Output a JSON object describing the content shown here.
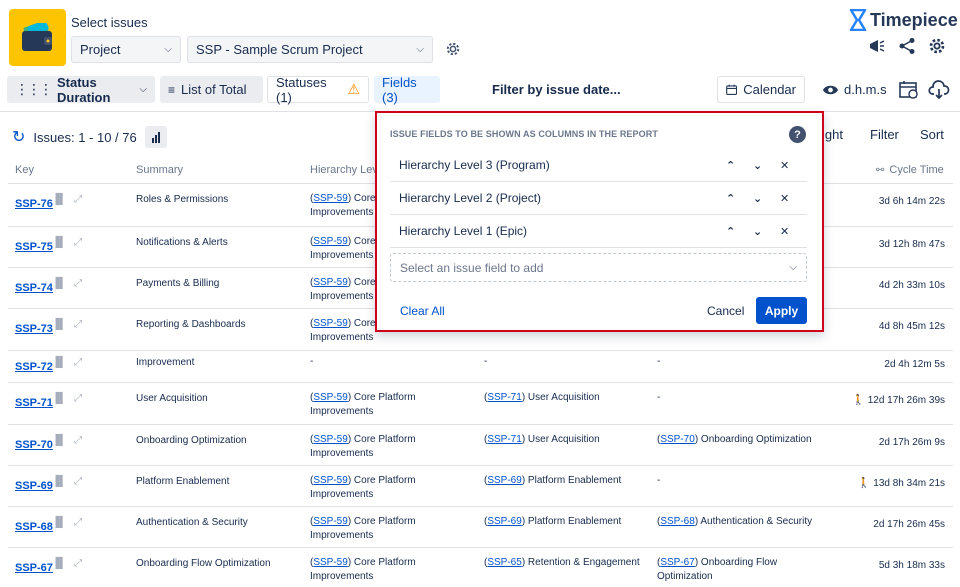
{
  "header": {
    "select_title": "Select issues",
    "scope_dropdown": "Project",
    "project_dropdown": "SSP - Sample Scrum Project",
    "brand": "Timepiece"
  },
  "toolbar": {
    "status_duration": "Status Duration",
    "list_of_total": "List of Total",
    "statuses": "Statuses (1)",
    "fields": "Fields (3)",
    "filter_date": "Filter by issue date...",
    "calendar": "Calendar",
    "dhms": "d.h.m.s"
  },
  "issues": {
    "count": "Issues: 1 - 10 / 76",
    "tab_right_partial": "ight",
    "filter": "Filter",
    "sort": "Sort"
  },
  "columns": {
    "key": "Key",
    "summary": "Summary",
    "hierarchy": "Hierarchy Leve",
    "cycle": "Cycle Time"
  },
  "rows": [
    {
      "key": "SSP-76",
      "summary": "Roles & Permissions",
      "l3_link": "SSP-59",
      "l3_text": " Core",
      "l3_line2": "Improvements",
      "l2_link": "",
      "l2_text": "",
      "l1_link": "",
      "l1_text": "",
      "l1_line2": "",
      "cycle": "3d 6h 14m 22s"
    },
    {
      "key": "SSP-75",
      "summary": "Notifications & Alerts",
      "l3_link": "SSP-59",
      "l3_text": " Core",
      "l3_line2": "Improvements",
      "l2_link": "",
      "l2_text": "",
      "l1_link": "",
      "l1_text": "",
      "l1_line2": "",
      "cycle": "3d 12h 8m 47s"
    },
    {
      "key": "SSP-74",
      "summary": "Payments & Billing",
      "l3_link": "SSP-59",
      "l3_text": " Core",
      "l3_line2": "Improvements",
      "l2_link": "",
      "l2_text": "",
      "l1_link": "",
      "l1_text": "",
      "l1_line2": "",
      "cycle": "4d 2h 33m 10s"
    },
    {
      "key": "SSP-73",
      "summary": "Reporting & Dashboards",
      "l3_link": "SSP-59",
      "l3_text": " Core",
      "l3_line2": "Improvements",
      "l2_link": "",
      "l2_text": "",
      "l1_link": "",
      "l1_text": "",
      "l1_line2": "",
      "cycle": "4d 8h 45m 12s"
    },
    {
      "key": "SSP-72",
      "summary": "Improvement",
      "l3_link": "",
      "l3_text": "-",
      "l3_line2": "",
      "l2_link": "",
      "l2_text": "-",
      "l1_link": "",
      "l1_text": "-",
      "l1_line2": "",
      "cycle": "2d 4h 12m 5s"
    },
    {
      "key": "SSP-71",
      "summary": "User Acquisition",
      "l3_link": "SSP-59",
      "l3_text": " Core Platform",
      "l3_line2": "Improvements",
      "l2_link": "SSP-71",
      "l2_text": " User Acquisition",
      "l1_link": "",
      "l1_text": "-",
      "l1_line2": "",
      "cycle": "12d 17h 26m 39s"
    },
    {
      "key": "SSP-70",
      "summary": "Onboarding Optimization",
      "l3_link": "SSP-59",
      "l3_text": " Core Platform",
      "l3_line2": "Improvements",
      "l2_link": "SSP-71",
      "l2_text": " User Acquisition",
      "l1_link": "SSP-70",
      "l1_text": " Onboarding Optimization",
      "l1_line2": "",
      "cycle": "2d 17h 26m 9s"
    },
    {
      "key": "SSP-69",
      "summary": "Platform Enablement",
      "l3_link": "SSP-59",
      "l3_text": " Core Platform",
      "l3_line2": "Improvements",
      "l2_link": "SSP-69",
      "l2_text": " Platform Enablement",
      "l1_link": "",
      "l1_text": "-",
      "l1_line2": "",
      "cycle": "13d 8h 34m 21s"
    },
    {
      "key": "SSP-68",
      "summary": "Authentication & Security",
      "l3_link": "SSP-59",
      "l3_text": " Core Platform",
      "l3_line2": "Improvements",
      "l2_link": "SSP-69",
      "l2_text": " Platform Enablement",
      "l1_link": "SSP-68",
      "l1_text": " Authentication & Security",
      "l1_line2": "",
      "cycle": "2d 17h 26m 45s"
    },
    {
      "key": "SSP-67",
      "summary": "Onboarding Flow Optimization",
      "l3_link": "SSP-59",
      "l3_text": " Core Platform",
      "l3_line2": "Improvements",
      "l2_link": "SSP-65",
      "l2_text": " Retention & Engagement",
      "l1_link": "SSP-67",
      "l1_text": " Onboarding Flow",
      "l1_line2": "Optimization",
      "cycle": "5d 3h 18m 33s"
    }
  ],
  "modal": {
    "title": "ISSUE FIELDS TO BE SHOWN AS COLUMNS IN THE REPORT",
    "help": "?",
    "fields": [
      "Hierarchy Level 3 (Program)",
      "Hierarchy Level 2 (Project)",
      "Hierarchy Level 1 (Epic)"
    ],
    "select_placeholder": "Select an issue field to add",
    "clear_all": "Clear All",
    "cancel": "Cancel",
    "apply": "Apply"
  },
  "colors": {
    "accent": "#0052cc",
    "highlight_border": "#d0021b",
    "app_icon_bg": "#ffc400",
    "warning": "#ff8b00"
  }
}
